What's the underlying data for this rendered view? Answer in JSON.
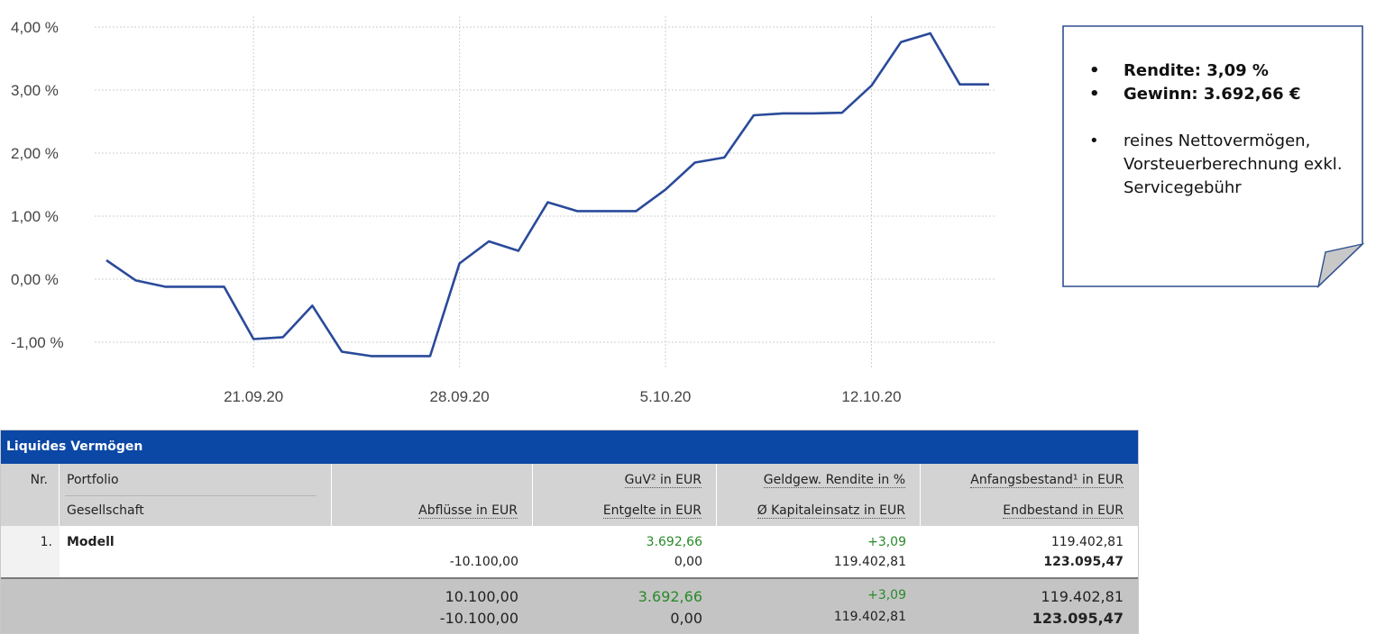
{
  "chart_data": {
    "type": "line",
    "y_tick_labels": [
      "4,00 %",
      "3,00 %",
      "2,00 %",
      "1,00 %",
      "0,00 %",
      "-1,00 %"
    ],
    "y_ticks": [
      4,
      3,
      2,
      1,
      0,
      -1
    ],
    "ylim": [
      -1.3,
      4.15
    ],
    "x_tick_labels": [
      "21.09.20",
      "28.09.20",
      "5.10.20",
      "12.10.20"
    ],
    "x_ticks": [
      "2020-09-21",
      "2020-09-28",
      "2020-10-05",
      "2020-10-12"
    ],
    "xlim": [
      "2020-09-16",
      "2020-10-16"
    ],
    "grid": true,
    "color": "#2a4a9a",
    "series": [
      {
        "x": [
          "2020-09-16",
          "2020-09-17",
          "2020-09-18",
          "2020-09-19",
          "2020-09-20",
          "2020-09-21",
          "2020-09-22",
          "2020-09-23",
          "2020-09-24",
          "2020-09-25",
          "2020-09-26",
          "2020-09-27",
          "2020-09-28",
          "2020-09-29",
          "2020-09-30",
          "2020-10-01",
          "2020-10-02",
          "2020-10-03",
          "2020-10-04",
          "2020-10-05",
          "2020-10-06",
          "2020-10-07",
          "2020-10-08",
          "2020-10-09",
          "2020-10-10",
          "2020-10-11",
          "2020-10-12",
          "2020-10-13",
          "2020-10-14",
          "2020-10-15",
          "2020-10-16"
        ],
        "values": [
          0.3,
          -0.02,
          -0.12,
          -0.12,
          -0.12,
          -0.95,
          -0.92,
          -0.42,
          -1.15,
          -1.22,
          -1.22,
          -1.22,
          0.25,
          0.6,
          0.45,
          1.22,
          1.08,
          1.08,
          1.08,
          1.42,
          1.85,
          1.93,
          2.6,
          2.63,
          2.63,
          2.64,
          3.07,
          3.76,
          3.9,
          3.09,
          3.09
        ]
      }
    ]
  },
  "note": {
    "items": [
      {
        "text": "Rendite: 3,09 %"
      },
      {
        "text": "Gewinn: 3.692,66 €"
      },
      {
        "text": "reines Nettovermögen, Vorsteuerberechnung exkl. Servicegebühr"
      }
    ],
    "colors": {
      "border": "#2e4f8f",
      "fold": "#c8c8c8"
    }
  },
  "table": {
    "title": "Liquides Vermögen",
    "headers": {
      "nr": "Nr.",
      "portfolio": "Portfolio",
      "company": "Gesellschaft",
      "outflows": "Abflüsse in EUR",
      "pnl": "GuV² in EUR",
      "fees": "Entgelte in EUR",
      "return": "Geldgew. Rendite in %",
      "capital": "Ø Kapitaleinsatz in EUR",
      "start": "Anfangsbestand¹ in EUR",
      "end": "Endbestand in EUR"
    },
    "row": {
      "nr": "1.",
      "name": "Modell",
      "outflows": "-10.100,00",
      "pnl": "3.692,66",
      "fees": "0,00",
      "return": "+3,09",
      "capital": "119.402,81",
      "start": "119.402,81",
      "end": "123.095,47"
    },
    "summary": {
      "inflows": "10.100,00",
      "outflows": "-10.100,00",
      "pnl": "3.692,66",
      "fees": "0,00",
      "return": "+3,09",
      "capital": "119.402,81",
      "start": "119.402,81",
      "end": "123.095,47"
    },
    "colors": {
      "title_bg": "#0b47a5",
      "header_bg": "#d3d3d3",
      "summary_bg": "#c4c4c4",
      "positive": "#2a8a2a"
    }
  }
}
